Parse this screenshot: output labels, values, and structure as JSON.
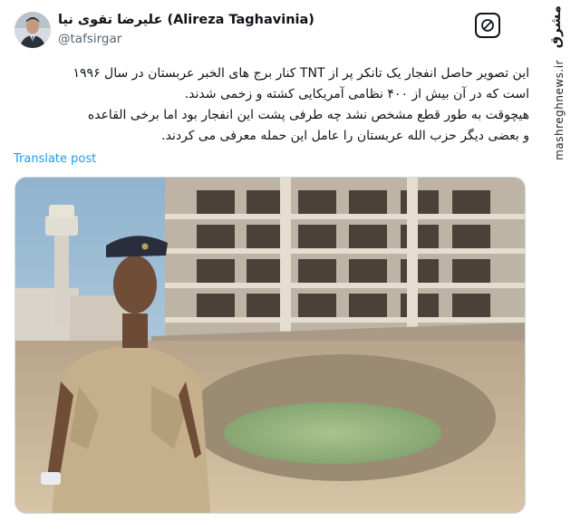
{
  "author": {
    "display_name": "علیرضا تقوی نیا (Alireza Taghavinia)",
    "handle": "@tafsirgar"
  },
  "tweet": {
    "lines": [
      "این تصویر حاصل انفجار یک تانکر پر از TNT کنار برج های الخبر عربستان در سال ۱۹۹۶",
      "است که در آن بیش از ۴۰۰ نظامی آمریکایی کشته و زخمی شدند.",
      "هیچوقت به طور قطع مشخص نشد چه طرفی پشت این انفجار بود اما برخی القاعده",
      "و بعضی دیگر حزب الله عربستان را عامل این حمله معرفی می کردند."
    ],
    "translate_label": "Translate post"
  },
  "brand": {
    "logo_text": "مشرق",
    "url": "mashreghnews.ir"
  },
  "icons": {
    "follow": "mute-icon",
    "avatar": "profile-photo"
  },
  "colors": {
    "link": "#1d9bf0",
    "text": "#0f1419",
    "secondary": "#536471"
  }
}
